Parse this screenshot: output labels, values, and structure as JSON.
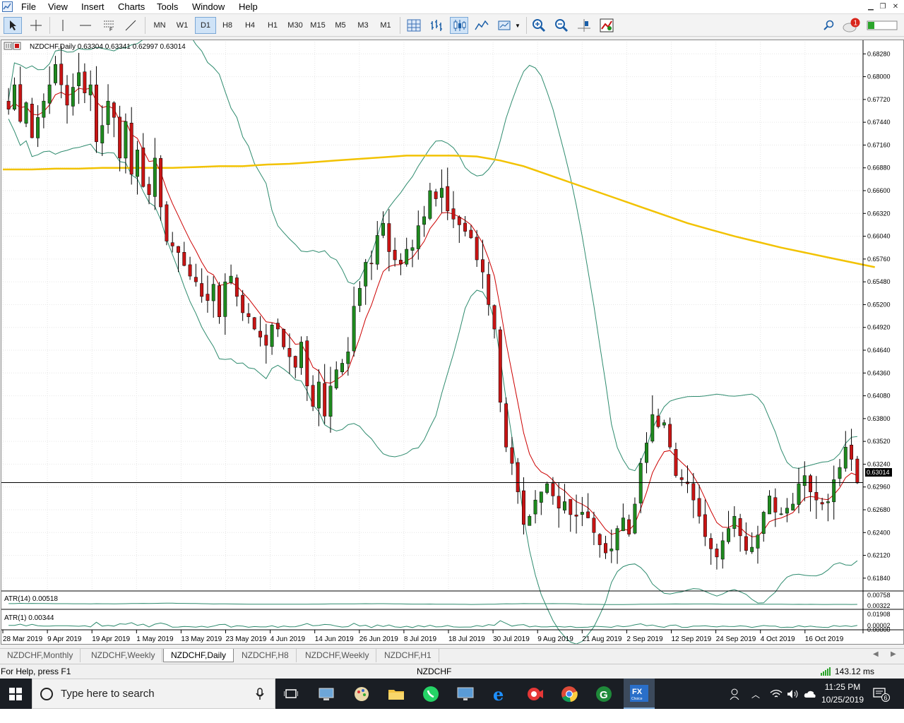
{
  "menu": {
    "items": [
      "File",
      "View",
      "Insert",
      "Charts",
      "Tools",
      "Window",
      "Help"
    ]
  },
  "toolbar": {
    "timeframes": [
      "MN",
      "W1",
      "D1",
      "H8",
      "H4",
      "H1",
      "M30",
      "M15",
      "M5",
      "M3",
      "M1"
    ],
    "active_timeframe": "D1"
  },
  "chart": {
    "header": "NZDCHF,Daily  0.63304 0.63341 0.62997 0.63014",
    "current_price_label": "0.63014",
    "price_axis": [
      "0.68280",
      "0.68000",
      "0.67720",
      "0.67440",
      "0.67160",
      "0.66880",
      "0.66600",
      "0.66320",
      "0.66040",
      "0.65760",
      "0.65480",
      "0.65200",
      "0.64920",
      "0.64640",
      "0.64360",
      "0.64080",
      "0.63800",
      "0.63520",
      "0.63240",
      "0.62960",
      "0.62680",
      "0.62400",
      "0.62120",
      "0.61840"
    ],
    "date_axis": [
      "28 Mar 2019",
      "9 Apr 2019",
      "19 Apr 2019",
      "1 May 2019",
      "13 May 2019",
      "23 May 2019",
      "4 Jun 2019",
      "14 Jun 2019",
      "26 Jun 2019",
      "8 Jul 2019",
      "18 Jul 2019",
      "30 Jul 2019",
      "9 Aug 2019",
      "21 Aug 2019",
      "2 Sep 2019",
      "12 Sep 2019",
      "24 Sep 2019",
      "4 Oct 2019",
      "16 Oct 2019"
    ],
    "indicator1": {
      "label": "ATR(14) 0.00518",
      "axis": [
        "0.00758",
        "0.00322"
      ]
    },
    "indicator2": {
      "label": "ATR(1) 0.00344",
      "axis": [
        "0.01908",
        "0.00002",
        "0.00000"
      ]
    },
    "colors": {
      "bull": "#1e8a1e",
      "bear": "#c81414",
      "ma_long": "#f2c200",
      "ma_short": "#cc0000",
      "bands": "#2e8b6e"
    }
  },
  "chart_data": {
    "type": "candlestick",
    "symbol": "NZDCHF",
    "timeframe": "Daily",
    "ohlc_last": {
      "open": 0.63304,
      "high": 0.63341,
      "low": 0.62997,
      "close": 0.63014
    },
    "ylim": [
      0.617,
      0.6843
    ],
    "closes": [
      0.676,
      0.679,
      0.6745,
      0.6768,
      0.6725,
      0.675,
      0.677,
      0.679,
      0.6815,
      0.679,
      0.6765,
      0.6787,
      0.6805,
      0.678,
      0.679,
      0.672,
      0.674,
      0.677,
      0.675,
      0.67,
      0.6745,
      0.668,
      0.671,
      0.6665,
      0.6655,
      0.67,
      0.664,
      0.6598,
      0.6592,
      0.6584,
      0.6568,
      0.6555,
      0.6548,
      0.653,
      0.6525,
      0.6545,
      0.6505,
      0.6548,
      0.6555,
      0.653,
      0.651,
      0.6505,
      0.649,
      0.648,
      0.647,
      0.6495,
      0.649,
      0.6468,
      0.6456,
      0.6443,
      0.6474,
      0.642,
      0.6395,
      0.6425,
      0.6383,
      0.642,
      0.644,
      0.6448,
      0.6462,
      0.6518,
      0.654,
      0.6572,
      0.657,
      0.6605,
      0.662,
      0.6585,
      0.6575,
      0.657,
      0.6588,
      0.659,
      0.6617,
      0.6628,
      0.666,
      0.665,
      0.6663,
      0.6635,
      0.6625,
      0.6618,
      0.661,
      0.6602,
      0.6575,
      0.656,
      0.652,
      0.649,
      0.64,
      0.6345,
      0.6325,
      0.629,
      0.625,
      0.626,
      0.628,
      0.629,
      0.63,
      0.6285,
      0.627,
      0.6278,
      0.6262,
      0.626,
      0.6265,
      0.6258,
      0.624,
      0.6225,
      0.6215,
      0.622,
      0.6245,
      0.6258,
      0.6238,
      0.6275,
      0.6325,
      0.635,
      0.6385,
      0.637,
      0.6375,
      0.6345,
      0.631,
      0.6305,
      0.63,
      0.628,
      0.626,
      0.6235,
      0.622,
      0.621,
      0.623,
      0.6245,
      0.626,
      0.6236,
      0.6218,
      0.6222,
      0.6237,
      0.6265,
      0.6285,
      0.6265,
      0.6263,
      0.627,
      0.6275,
      0.63,
      0.631,
      0.629,
      0.628,
      0.6275,
      0.6278,
      0.6305,
      0.632,
      0.6345,
      0.633,
      0.6301
    ],
    "ma_long": [
      0.6686,
      0.6686,
      0.6687,
      0.6687,
      0.6688,
      0.6688,
      0.6688,
      0.6688,
      0.6689,
      0.669,
      0.669,
      0.6692,
      0.6693,
      0.6695,
      0.6697,
      0.6699,
      0.6701,
      0.6703,
      0.6703,
      0.6703,
      0.6702,
      0.6697,
      0.669,
      0.668,
      0.667,
      0.666,
      0.665,
      0.664,
      0.663,
      0.662,
      0.6612,
      0.6604,
      0.6597,
      0.659,
      0.6584,
      0.6578,
      0.6572,
      0.6566
    ],
    "ma_long_x": [
      0,
      4,
      8,
      12,
      16,
      20,
      24,
      28,
      32,
      36,
      40,
      44,
      48,
      52,
      56,
      60,
      64,
      68,
      72,
      76,
      80,
      84,
      88,
      92,
      96,
      100,
      104,
      108,
      112,
      116,
      120,
      124,
      128,
      132,
      136,
      140,
      144,
      148
    ]
  }
}
